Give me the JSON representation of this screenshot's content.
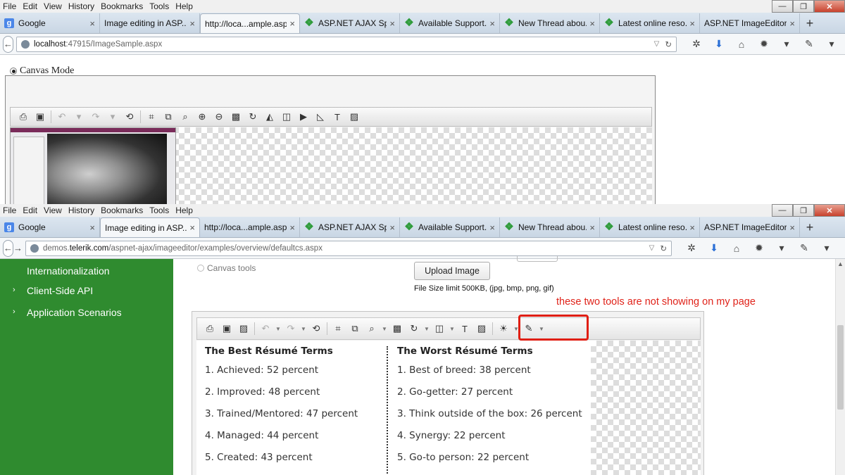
{
  "menu": [
    "File",
    "Edit",
    "View",
    "History",
    "Bookmarks",
    "Tools",
    "Help"
  ],
  "window_controls": {
    "minimize": "—",
    "restore": "❐",
    "close": "✕"
  },
  "tabs": [
    {
      "label": "Google",
      "icon": "g"
    },
    {
      "label": "Image editing in ASP....",
      "icon": "none"
    },
    {
      "label": "http://loca...ample.aspx",
      "icon": "none"
    },
    {
      "label": "ASP.NET AJAX Spl...",
      "icon": "telerik"
    },
    {
      "label": "Available Support...",
      "icon": "telerik"
    },
    {
      "label": "New Thread abou...",
      "icon": "telerik"
    },
    {
      "label": "Latest online reso...",
      "icon": "telerik"
    },
    {
      "label": "ASP.NET ImageEditor ...",
      "icon": "none"
    }
  ],
  "window1": {
    "active_tab": 2,
    "url_host": "localhost",
    "url_rest": ":47915/ImageSample.aspx",
    "canvas_mode_label": "Canvas Mode"
  },
  "window2": {
    "active_tab": 1,
    "url_prefix": "demos.",
    "url_host": "telerik.com",
    "url_rest": "/aspnet-ajax/imageeditor/examples/overview/defaultcs.aspx",
    "sidebar": [
      {
        "label": "Internationalization",
        "caret": false
      },
      {
        "label": "Client-Side API",
        "caret": true
      },
      {
        "label": "Application Scenarios",
        "caret": true
      }
    ],
    "canvas_tools_label": "Canvas tools",
    "upload_button": "Upload Image",
    "file_size_note": "File Size limit 500KB, (jpg, bmp, png, gif)",
    "annotation": "these two tools are not showing on my page",
    "doc": {
      "left_title": "The Best Résumé Terms",
      "left_items": [
        "1. Achieved: 52 percent",
        "2. Improved: 48 percent",
        "3. Trained/Mentored: 47 percent",
        "4. Managed: 44 percent",
        "5. Created: 43 percent"
      ],
      "right_title": "The Worst Résumé Terms",
      "right_items": [
        "1. Best of breed: 38 percent",
        "2. Go-getter: 27 percent",
        "3. Think outside of the box: 26 percent",
        "4. Synergy: 22 percent",
        "5. Go-to person: 22 percent"
      ]
    }
  },
  "colors": {
    "sidebar_green": "#2f8b2f",
    "highlight_red": "#e01e12",
    "annotation_red": "#e0231a"
  }
}
